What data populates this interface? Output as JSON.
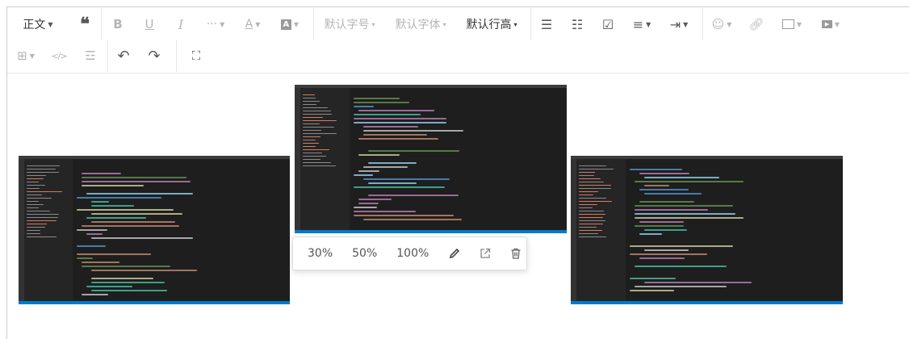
{
  "toolbar": {
    "heading": "正文",
    "font_size": "默认字号",
    "font_family": "默认字体",
    "line_height": "默认行高"
  },
  "image_toolbar": {
    "width_30": "30%",
    "width_50": "50%",
    "width_100": "100%"
  }
}
